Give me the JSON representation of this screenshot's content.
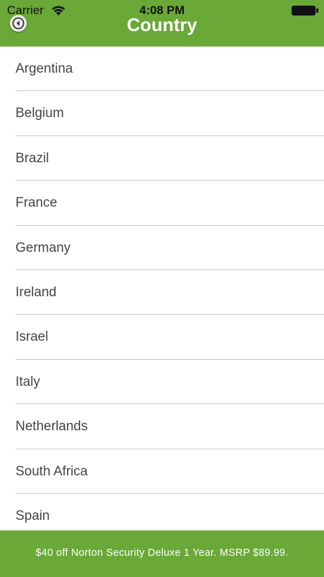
{
  "status_bar": {
    "carrier": "Carrier",
    "time": "4:08 PM"
  },
  "header": {
    "title": "Country",
    "back_icon": "back-arrow-circle-icon",
    "background_color": "#6aa838"
  },
  "countries": [
    {
      "label": "Argentina"
    },
    {
      "label": "Belgium"
    },
    {
      "label": "Brazil"
    },
    {
      "label": "France"
    },
    {
      "label": "Germany"
    },
    {
      "label": "Ireland"
    },
    {
      "label": "Israel"
    },
    {
      "label": "Italy"
    },
    {
      "label": "Netherlands"
    },
    {
      "label": "South Africa"
    },
    {
      "label": "Spain"
    }
  ],
  "footer": {
    "promo_text": "$40 off Norton Security Deluxe 1 Year. MSRP $89.99.",
    "background_color": "#6aa838"
  }
}
